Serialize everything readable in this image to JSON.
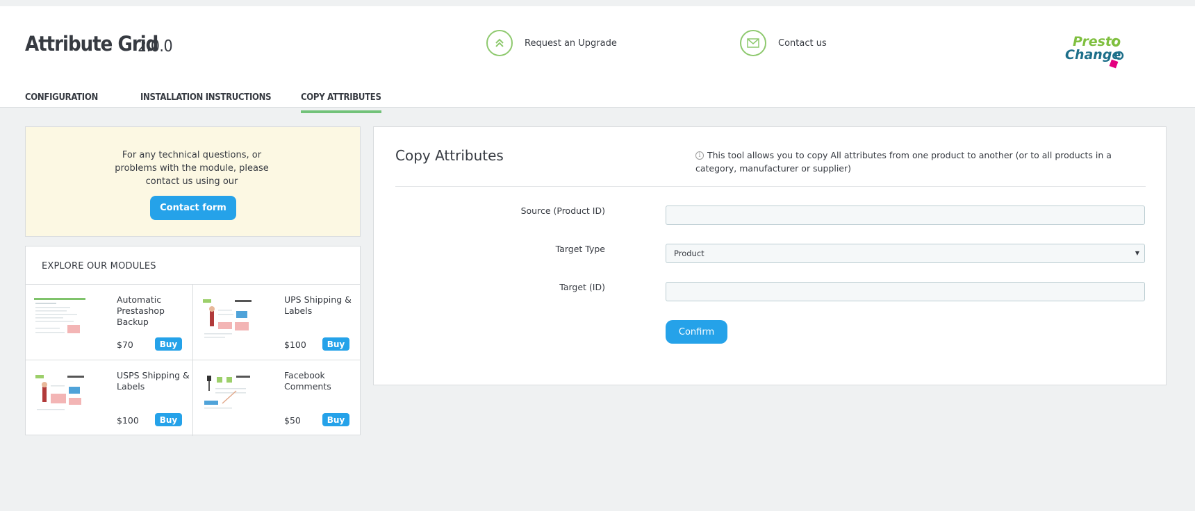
{
  "app": {
    "title": "Attribute Grid",
    "version": "2.0.0"
  },
  "header_links": {
    "upgrade": {
      "label": "Request an Upgrade",
      "icon": "double-chevron-up-icon"
    },
    "contact": {
      "label": "Contact us",
      "icon": "envelope-icon"
    }
  },
  "brand": {
    "name": "Presto Changeo",
    "accent": "#72c279"
  },
  "tabs": [
    {
      "label": "CONFIGURATION",
      "active": false
    },
    {
      "label": "INSTALLATION INSTRUCTIONS",
      "active": false
    },
    {
      "label": "COPY ATTRIBUTES",
      "active": true
    }
  ],
  "help_box": {
    "text": "For any technical questions, or problems with the module, please contact us using our",
    "button_label": "Contact form"
  },
  "modules": {
    "title": "EXPLORE OUR MODULES",
    "items": [
      {
        "name": "Automatic Prestashop Backup",
        "price": "$70",
        "buy_label": "Buy"
      },
      {
        "name": "UPS Shipping & Labels",
        "price": "$100",
        "buy_label": "Buy"
      },
      {
        "name": "USPS Shipping & Labels",
        "price": "$100",
        "buy_label": "Buy"
      },
      {
        "name": "Facebook Comments",
        "price": "$50",
        "buy_label": "Buy"
      }
    ]
  },
  "copy_panel": {
    "title": "Copy Attributes",
    "info": "This tool allows you to copy All attributes from one product to another (or to all products in a category, manufacturer or supplier)",
    "fields": {
      "source": {
        "label": "Source (Product ID)",
        "value": ""
      },
      "target_type": {
        "label": "Target Type",
        "value": "Product"
      },
      "target": {
        "label": "Target (ID)",
        "value": ""
      }
    },
    "confirm_label": "Confirm"
  },
  "colors": {
    "primary_button": "#25a2e9",
    "help_bg": "#fcf8e3",
    "page_bg": "#eff1f2"
  }
}
